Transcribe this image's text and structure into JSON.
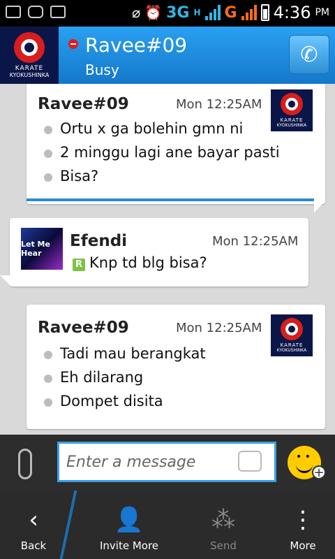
{
  "status_bar": {
    "network": "3G",
    "network_sub": "H",
    "network_carrier": "G",
    "time": "4:36",
    "ampm": "PM"
  },
  "header": {
    "contact_name": "Ravee#09",
    "contact_status": "Busy",
    "avatar_text_1": "KARATE",
    "avatar_text_2": "KYOKUSHINKA"
  },
  "messages": [
    {
      "sender": "Ravee#09",
      "time": "Mon 12:25AM",
      "lines": [
        "Ortu x ga bolehin gmn ni",
        "2 minggu lagi ane bayar pasti",
        "Bisa?"
      ]
    },
    {
      "sender": "Efendi",
      "time": "Mon 12:25AM",
      "avatar_text": "Let Me Hear",
      "lines": [
        "Knp td blg bisa?"
      ]
    },
    {
      "sender": "Ravee#09",
      "time": "Mon 12:25AM",
      "lines": [
        "Tadi mau berangkat",
        "Eh dilarang",
        "Dompet disita"
      ]
    }
  ],
  "composer": {
    "placeholder": "Enter a message"
  },
  "bottom_bar": {
    "back": "Back",
    "invite": "Invite More",
    "send": "Send",
    "more": "More"
  }
}
